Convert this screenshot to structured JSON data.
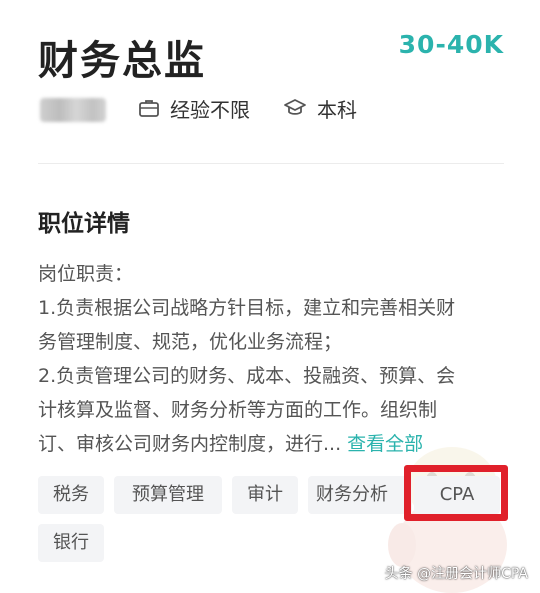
{
  "job": {
    "title": "财务总监",
    "salary": "30-40K",
    "experience": "经验不限",
    "education": "本科"
  },
  "details": {
    "heading": "职位详情",
    "lines": [
      "岗位职责：",
      "1.负责根据公司战略方针目标，建立和完善相关财",
      "务管理制度、规范，优化业务流程；",
      "2.负责管理公司的财务、成本、投融资、预算、会",
      "计核算及监督、财务分析等方面的工作。组织制"
    ],
    "last_line": "订、审核公司财务内控制度，进行...",
    "see_all": "查看全部"
  },
  "tags": [
    "税务",
    "预算管理",
    "审计",
    "财务分析",
    "CPA",
    "银行"
  ],
  "watermark": "头条 @注册会计师CPA",
  "colors": {
    "accent": "#2bb3ad",
    "highlight_box": "#e0202a"
  }
}
